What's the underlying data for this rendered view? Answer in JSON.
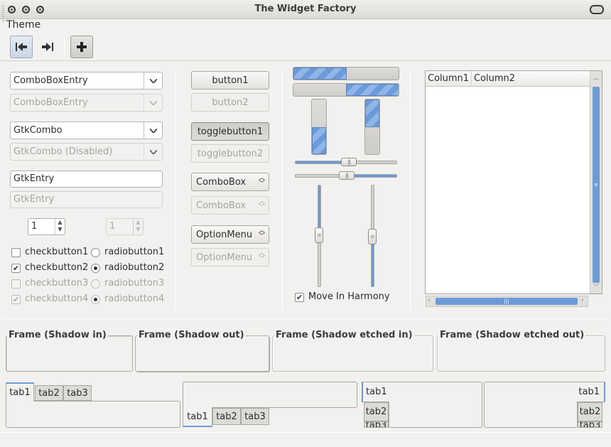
{
  "window": {
    "title": "The Widget Factory"
  },
  "menu": {
    "theme": "Theme"
  },
  "toolbar": {
    "icons": [
      "go-first-icon",
      "go-last-icon",
      "add-icon"
    ]
  },
  "left": {
    "combo_entry": "ComboBoxEntry",
    "combo_entry_disabled": "ComboBoxEntry",
    "gtk_combo": "GtkCombo",
    "gtk_combo_disabled": "GtkCombo (Disabled)",
    "entry": "GtkEntry",
    "entry_disabled": "GtkEntry",
    "spin_value": "1",
    "spin_disabled_value": "1",
    "checks": [
      "checkbutton1",
      "checkbutton2",
      "checkbutton3",
      "checkbutton4"
    ],
    "radios": [
      "radiobutton1",
      "radiobutton2",
      "radiobutton3",
      "radiobutton4"
    ]
  },
  "middle": {
    "button1": "button1",
    "button2": "button2",
    "toggle1": "togglebutton1",
    "toggle2": "togglebutton2",
    "combobox": "ComboBox",
    "combobox_disabled": "ComboBox",
    "optionmenu": "OptionMenu",
    "optionmenu_disabled": "OptionMenu"
  },
  "range": {
    "progress_h1": 0.5,
    "progress_h2": 0.5,
    "progress_v1": 0.5,
    "progress_v2": 0.5,
    "move_in_harmony": "Move In Harmony"
  },
  "tree": {
    "columns": [
      "Column1",
      "Column2"
    ]
  },
  "frames": [
    "Frame (Shadow in)",
    "Frame (Shadow out)",
    "Frame (Shadow etched in)",
    "Frame (Shadow etched out)"
  ],
  "tabs": {
    "labels": [
      "tab1",
      "tab2",
      "tab3"
    ]
  },
  "colors": {
    "accent": "#6b9bd8",
    "background": "#f2f1f0"
  }
}
